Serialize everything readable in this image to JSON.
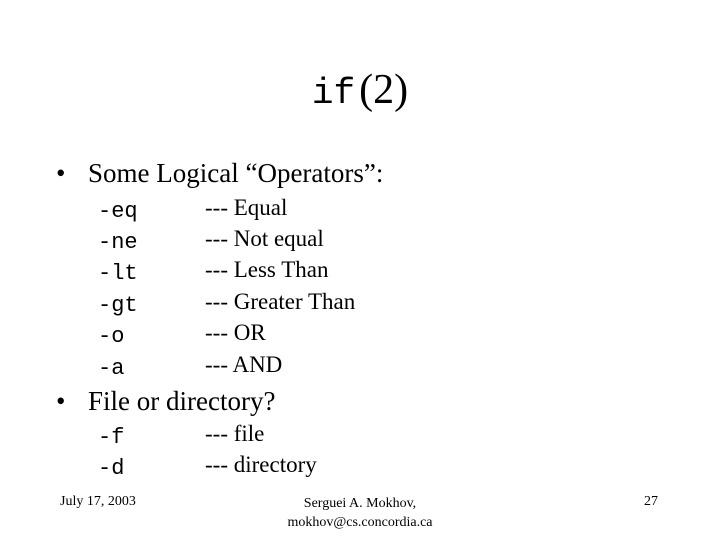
{
  "slide": {
    "title": {
      "code": "if",
      "rest": "(2)"
    },
    "sections": [
      {
        "heading": "Some Logical “Operators”:",
        "items": [
          {
            "op": "-eq",
            "desc": "--- Equal"
          },
          {
            "op": "-ne",
            "desc": "--- Not equal"
          },
          {
            "op": "-lt",
            "desc": "--- Less Than"
          },
          {
            "op": "-gt",
            "desc": "--- Greater Than"
          },
          {
            "op": "-o",
            "desc": "--- OR"
          },
          {
            "op": "-a",
            "desc": "--- AND"
          }
        ]
      },
      {
        "heading": "File or directory?",
        "items": [
          {
            "op": "-f",
            "desc": "--- file"
          },
          {
            "op": "-d",
            "desc": "--- directory"
          }
        ]
      }
    ],
    "bullet_glyph": "•",
    "footer": {
      "date": "July 17, 2003",
      "author": "Serguei A. Mokhov,",
      "email": "mokhov@cs.concordia.ca",
      "page": "27"
    }
  }
}
